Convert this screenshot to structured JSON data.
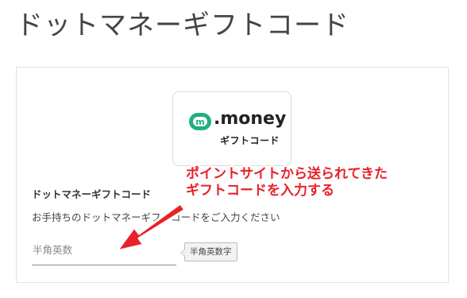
{
  "page": {
    "title": "ドットマネーギフトコード"
  },
  "logo": {
    "wordmark": ".money",
    "subtitle": "ギフトコード",
    "mark_letter": "m",
    "brand_color": "#20b07f"
  },
  "form": {
    "section_label": "ドットマネーギフトコード",
    "description": "お手持ちのドットマネーギフトコードをご入力ください",
    "input_value": "",
    "input_placeholder": "半角英数",
    "hint": "半角英数字"
  },
  "annotation": {
    "line1": "ポイントサイトから送られてきた",
    "line2": "ギフトコードを入力する",
    "color": "#e8212a",
    "arrow_icon": "red-arrow-icon"
  }
}
